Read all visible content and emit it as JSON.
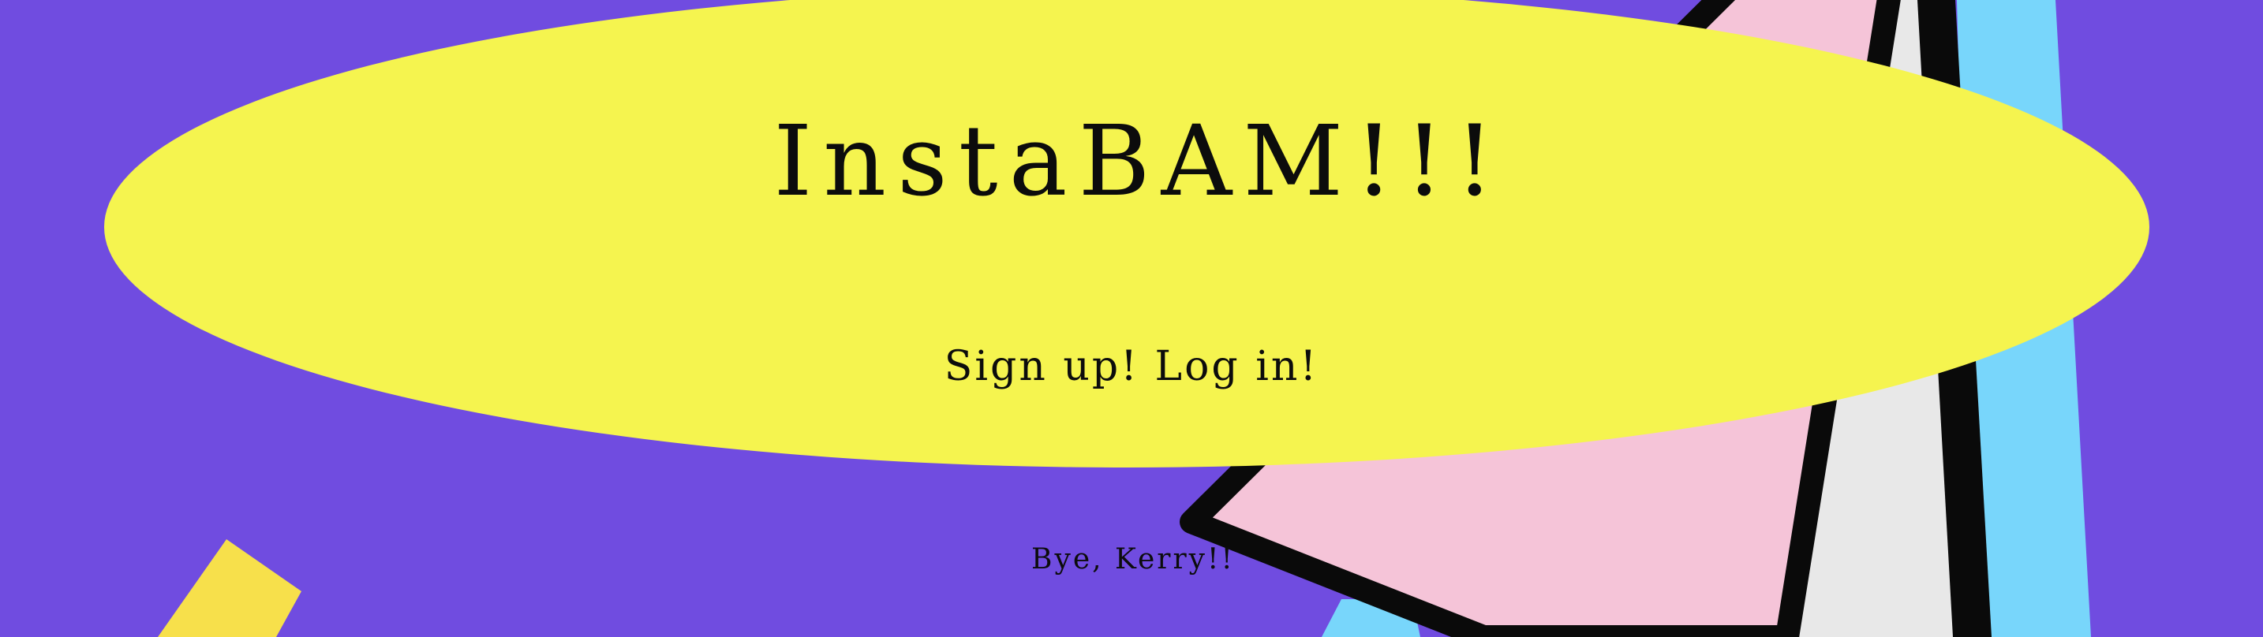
{
  "page": {
    "title": "InstaBAM!!!",
    "auth": {
      "sign_up_label": "Sign up!",
      "log_in_label": "Log in!"
    },
    "farewell": "Bye, Kerry!!"
  },
  "theme": {
    "background": "#704ce0",
    "ellipse_fill": "#f5f44f",
    "pink_shape": "#f5c4d8",
    "white_shape": "#e8e8e8",
    "cyan_shape": "#78d6fb",
    "yellow_shard": "#f7e04b",
    "outline": "#0a0a0a",
    "text": "#0c0c0c"
  }
}
